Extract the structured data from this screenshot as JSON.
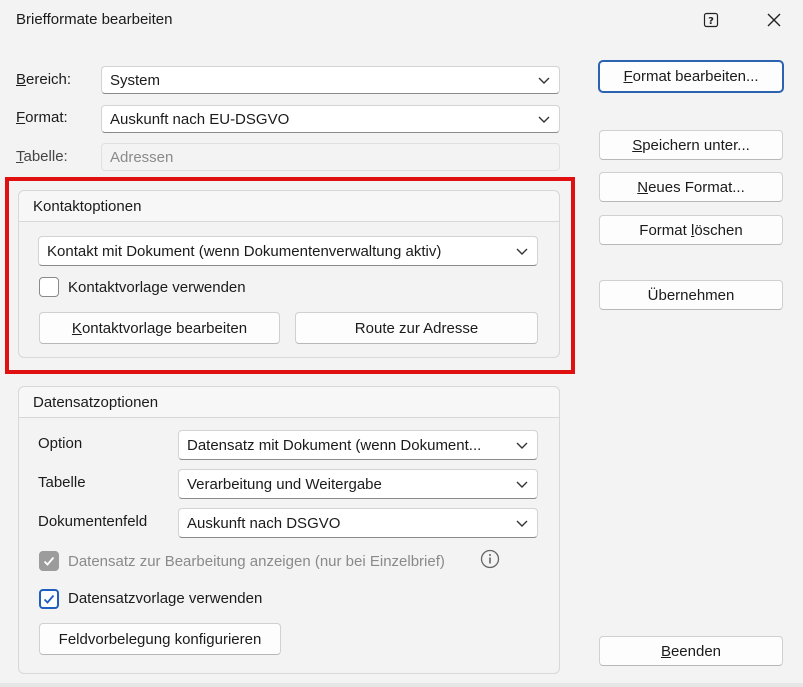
{
  "dialog": {
    "title": "Briefformate bearbeiten"
  },
  "top": {
    "bereich_label_prefix": "B",
    "bereich_label_rest": "ereich:",
    "bereich_value": "System",
    "format_label_prefix": "F",
    "format_label_rest": "ormat:",
    "format_value": "Auskunft nach EU-DSGVO",
    "tabelle_label_prefix": "T",
    "tabelle_label_rest": "abelle:",
    "tabelle_value": "Adressen"
  },
  "kontakt": {
    "group_title": "Kontaktoptionen",
    "combo_value": "Kontakt mit Dokument (wenn Dokumentenverwaltung aktiv)",
    "checkbox_label": "Kontaktvorlage verwenden",
    "edit_button_prefix": "K",
    "edit_button_rest": "ontaktvorlage bearbeiten",
    "route_button": "Route zur Adresse"
  },
  "datensatz": {
    "group_title": "Datensatzoptionen",
    "option_label": "Option",
    "option_value": "Datensatz mit Dokument (wenn Dokument...",
    "tabelle_label": "Tabelle",
    "tabelle_value": "Verarbeitung und Weitergabe",
    "feld_label": "Dokumentenfeld",
    "feld_value": "Auskunft nach DSGVO",
    "anzeigen_label": "Datensatz zur Bearbeitung anzeigen (nur bei Einzelbrief)",
    "vorlage_label": "Datensatzvorlage verwenden",
    "feld_button": "Feldvorbelegung konfigurieren"
  },
  "side_buttons": {
    "format_bearbeiten_prefix": "F",
    "format_bearbeiten_rest": "ormat bearbeiten...",
    "speichern_prefix": "S",
    "speichern_rest": "peichern unter...",
    "neues_prefix": "N",
    "neues_rest": "eues Format...",
    "loeschen_pre": "Format ",
    "loeschen_u": "l",
    "loeschen_post": "öschen",
    "uebernehmen": "Übernehmen",
    "beenden_prefix": "B",
    "beenden_rest": "eenden"
  },
  "colors": {
    "accent": "#1f5fbf",
    "highlight": "#e01010"
  }
}
